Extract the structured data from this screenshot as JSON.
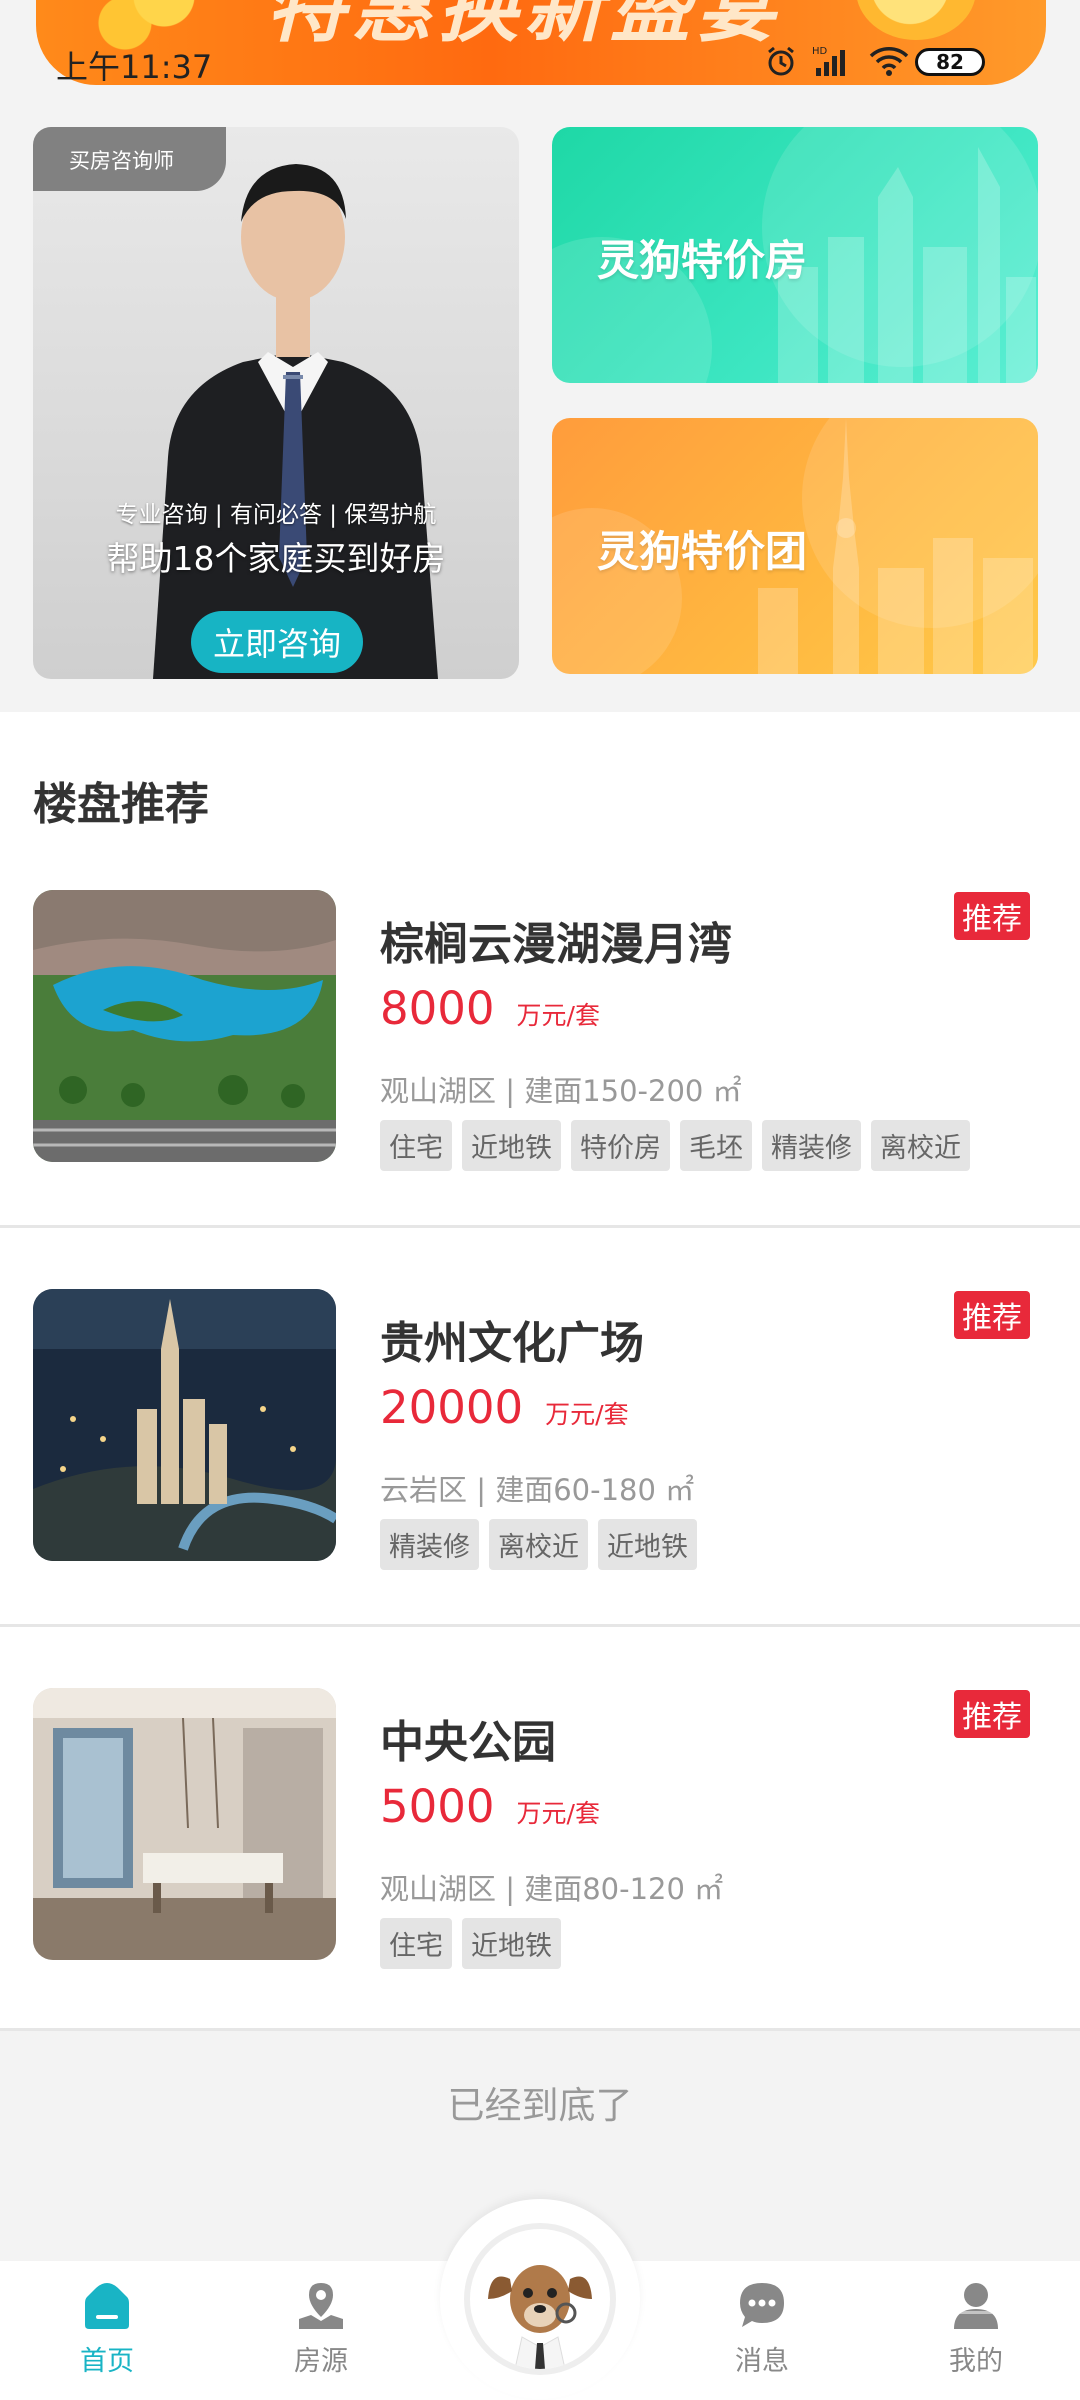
{
  "status_bar": {
    "time": "上午11:37",
    "battery": "82"
  },
  "banner": {
    "text": "特惠换新盛宴"
  },
  "promo": {
    "consult_tag": "买房咨询师",
    "consult_sub": "专业咨询 | 有问必答 | 保驾护航",
    "consult_main": "帮助18个家庭买到好房",
    "consult_button": "立即咨询",
    "card_green_title": "灵狗特价房",
    "card_orange_title": "灵狗特价团"
  },
  "section_title": "楼盘推荐",
  "listings": [
    {
      "name": "棕榈云漫湖漫月湾",
      "badge": "推荐",
      "price": "8000",
      "unit": "万元/套",
      "meta": "观山湖区 | 建面150-200 ㎡",
      "tags": [
        "住宅",
        "近地铁",
        "特价房",
        "毛坯",
        "精装修",
        "离校近"
      ]
    },
    {
      "name": "贵州文化广场",
      "badge": "推荐",
      "price": "20000",
      "unit": "万元/套",
      "meta": "云岩区 | 建面60-180 ㎡",
      "tags": [
        "精装修",
        "离校近",
        "近地铁"
      ]
    },
    {
      "name": "中央公园",
      "badge": "推荐",
      "price": "5000",
      "unit": "万元/套",
      "meta": "观山湖区 | 建面80-120 ㎡",
      "tags": [
        "住宅",
        "近地铁"
      ]
    }
  ],
  "end_text": "已经到底了",
  "nav": {
    "home": "首页",
    "listings": "房源",
    "messages": "消息",
    "mine": "我的"
  },
  "colors": {
    "accent": "#19b4c5",
    "price": "#e8293a",
    "badge": "#e8293a"
  }
}
